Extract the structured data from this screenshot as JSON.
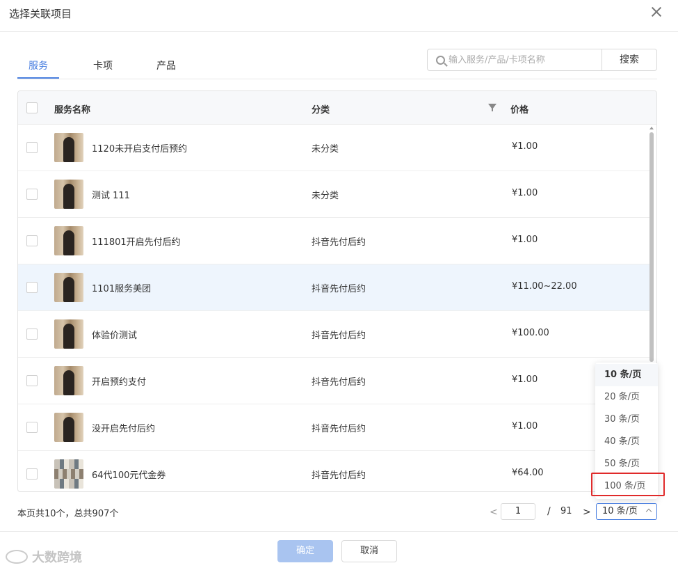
{
  "dialog": {
    "title": "选择关联项目"
  },
  "tabs": [
    {
      "label": "服务",
      "active": true
    },
    {
      "label": "卡项",
      "active": false
    },
    {
      "label": "产品",
      "active": false
    }
  ],
  "search": {
    "placeholder": "输入服务/产品/卡项名称",
    "value": "",
    "button_label": "搜索"
  },
  "table": {
    "columns": [
      "服务名称",
      "分类",
      "价格"
    ],
    "rows": [
      {
        "name": "1120未开启支付后预约",
        "category": "未分类",
        "price": "¥1.00",
        "highlighted": false,
        "thumb": "photo"
      },
      {
        "name": "测试 111",
        "category": "未分类",
        "price": "¥1.00",
        "highlighted": false,
        "thumb": "photo"
      },
      {
        "name": "111801开启先付后约",
        "category": "抖音先付后约",
        "price": "¥1.00",
        "highlighted": false,
        "thumb": "photo"
      },
      {
        "name": "1101服务美团",
        "category": "抖音先付后约",
        "price": "¥11.00~22.00",
        "highlighted": true,
        "thumb": "photo"
      },
      {
        "name": "体验价测试",
        "category": "抖音先付后约",
        "price": "¥100.00",
        "highlighted": false,
        "thumb": "photo"
      },
      {
        "name": "开启预约支付",
        "category": "抖音先付后约",
        "price": "¥1.00",
        "highlighted": false,
        "thumb": "photo"
      },
      {
        "name": "没开启先付后约",
        "category": "抖音先付后约",
        "price": "¥1.00",
        "highlighted": false,
        "thumb": "photo"
      },
      {
        "name": "64代100元代金券",
        "category": "抖音先付后约",
        "price": "¥64.00",
        "highlighted": false,
        "thumb": "collage"
      }
    ]
  },
  "page_size_dropdown": {
    "options": [
      "10 条/页",
      "20 条/页",
      "30 条/页",
      "40 条/页",
      "50 条/页",
      "100 条/页"
    ],
    "selected": "10 条/页",
    "highlighted_option": "100 条/页"
  },
  "pagination": {
    "summary": "本页共10个，总共907个",
    "prev": "<",
    "next": ">",
    "current_page": "1",
    "separator": "/",
    "total_pages": "91",
    "page_size": "10 条/页"
  },
  "actions": {
    "ok_label": "确定",
    "cancel_label": "取消"
  },
  "watermark": {
    "text": "大数跨境"
  },
  "colors": {
    "accent": "#4a7fe0",
    "ok_disabled": "#a9c4f0",
    "highlight_row": "#eef5fd",
    "annotation_red": "#e02a2a"
  }
}
